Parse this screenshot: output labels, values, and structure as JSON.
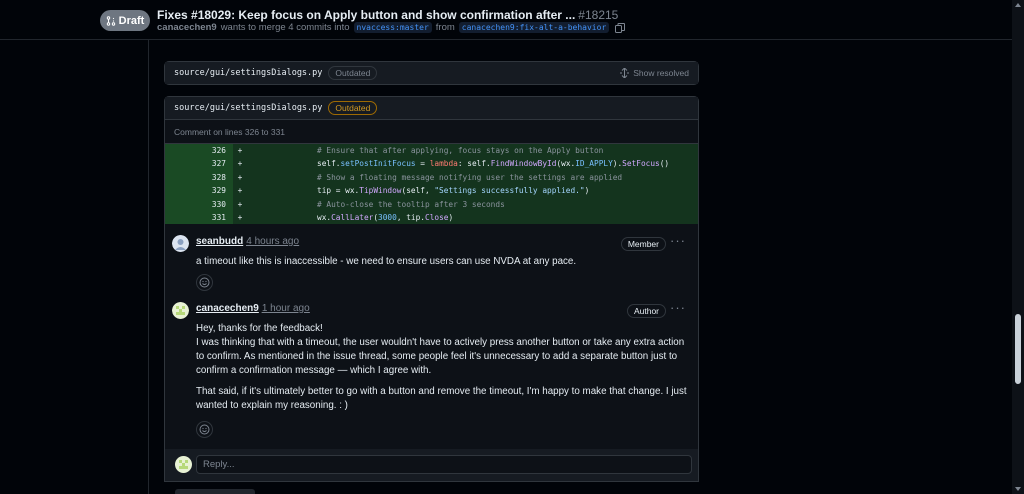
{
  "header": {
    "draft_label": "Draft",
    "title": "Fixes #18029: Keep focus on Apply button and show confirmation after ...",
    "number": "#18215",
    "author": "canacechen9",
    "merge_text": "wants to merge 4 commits into",
    "base_branch": "nvaccess:master",
    "from_text": "from",
    "head_branch": "canacechen9:fix-alt-a-behavior"
  },
  "files": [
    {
      "name": "source/gui/settingsDialogs.py",
      "badge": "Outdated",
      "action": "Show resolved"
    },
    {
      "name": "source/gui/settingsDialogs.py",
      "badge": "Outdated"
    }
  ],
  "thread": {
    "comment_on": "Comment on lines 326 to 331",
    "diff": [
      {
        "num": "326",
        "sign": "+"
      },
      {
        "num": "327",
        "sign": "+"
      },
      {
        "num": "328",
        "sign": "+"
      },
      {
        "num": "329",
        "sign": "+"
      },
      {
        "num": "330",
        "sign": "+"
      },
      {
        "num": "331",
        "sign": "+"
      }
    ],
    "code": {
      "l326": "# Ensure that after applying, focus stays on the Apply button",
      "l327a": "self.",
      "l327b": "setPostInitFocus",
      "l327c": " = ",
      "l327d": "lambda",
      "l327e": ": self.",
      "l327f": "FindWindowById",
      "l327g": "(wx.",
      "l327h": "ID_APPLY",
      "l327i": ").",
      "l327j": "SetFocus",
      "l327k": "()",
      "l328": "# Show a floating message notifying user the settings are applied",
      "l329a": "tip = wx.",
      "l329b": "TipWindow",
      "l329c": "(self, ",
      "l329d": "\"Settings successfully applied.\"",
      "l329e": ")",
      "l330": "# Auto-close the tooltip after 3 seconds",
      "l331a": "wx.",
      "l331b": "CallLater",
      "l331c": "(",
      "l331d": "3000",
      "l331e": ", tip.",
      "l331f": "Close",
      "l331g": ")"
    },
    "comments": [
      {
        "author": "seanbudd",
        "time": "4 hours ago",
        "role": "Member",
        "body": [
          "a timeout like this is inaccessible - we need to ensure users can use NVDA at any pace."
        ]
      },
      {
        "author": "canacechen9",
        "time": "1 hour ago",
        "role": "Author",
        "body": [
          "Hey, thanks for the feedback!",
          "I was thinking that with a timeout, the user wouldn't have to actively press another button or take any extra action to confirm. As mentioned in the issue thread, some people feel it's unnecessary to add a separate button just to confirm a confirmation message — which I agree with.",
          "That said, if it's ultimately better to go with a button and remove the timeout, I'm happy to make that change. I just wanted to explain my reasoning. : )"
        ]
      }
    ],
    "reply_placeholder": "Reply..."
  },
  "colors": {
    "background": "#010409",
    "diff_added": "#14341e",
    "accent_link": "#4493f8",
    "warning": "#d29922"
  }
}
